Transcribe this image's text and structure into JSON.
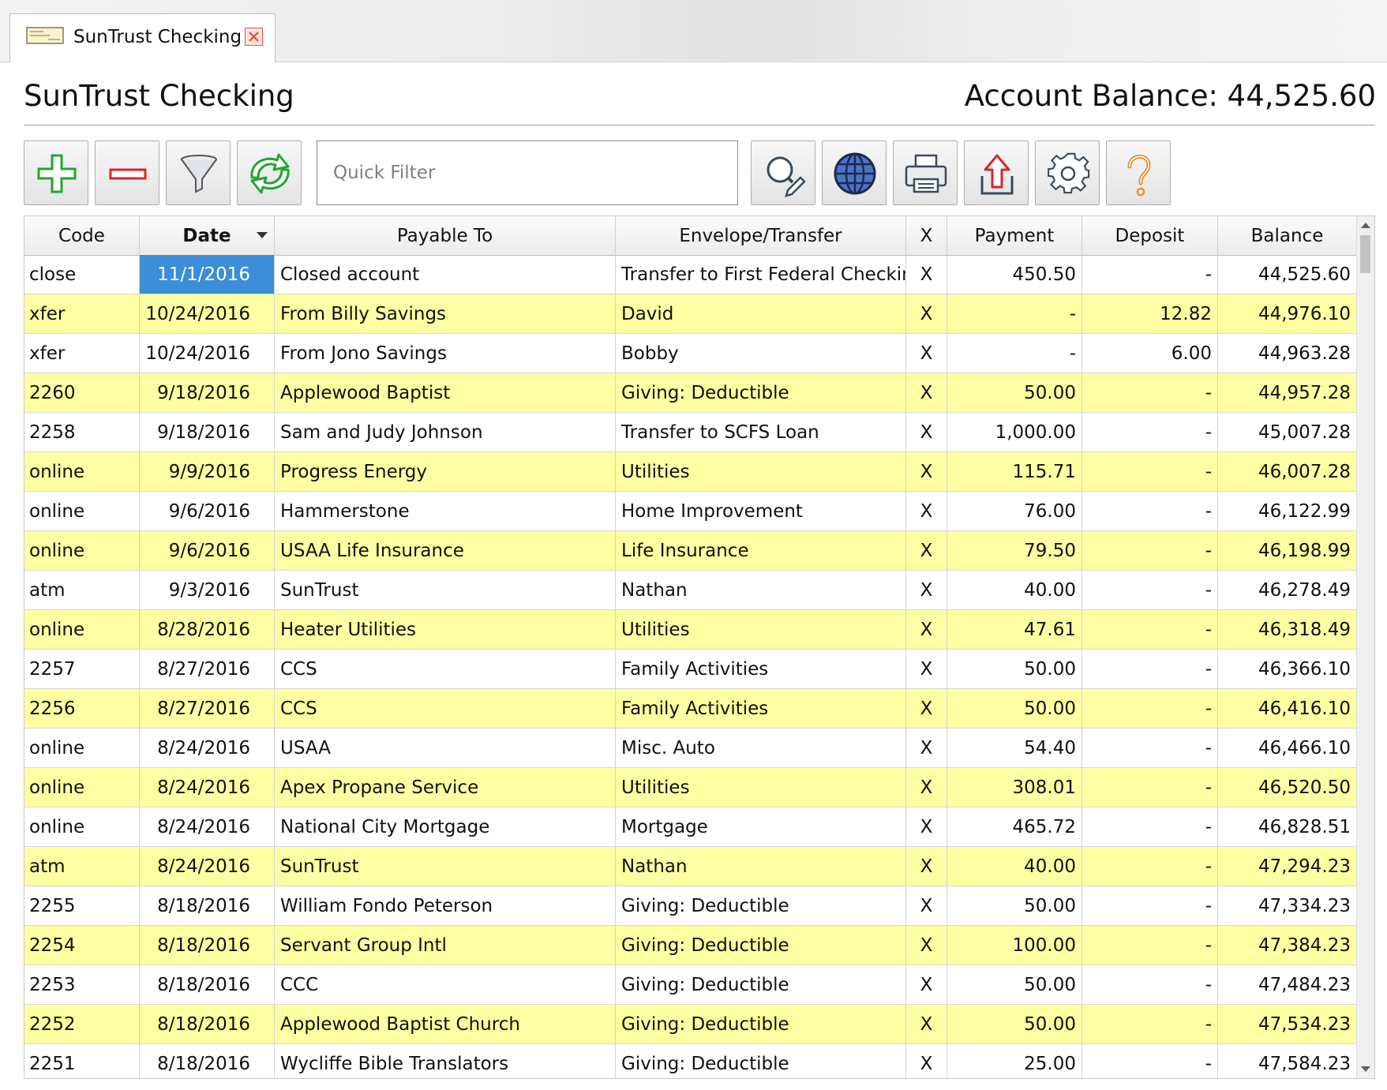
{
  "tab": {
    "title": "SunTrust Checking",
    "icon": "check-document-icon",
    "close_icon": "close-icon"
  },
  "header": {
    "title": "SunTrust Checking",
    "balance": "Account Balance: 44,525.60"
  },
  "toolbar": {
    "add_icon": "plus-icon",
    "delete_icon": "minus-icon",
    "filter_icon": "funnel-icon",
    "sync_icon": "sync-arrows-icon",
    "quick_filter_placeholder": "Quick Filter",
    "quick_filter_value": "",
    "search_icon": "magnifier-pencil-icon",
    "web_icon": "globe-icon",
    "print_icon": "printer-icon",
    "export_icon": "export-upload-icon",
    "settings_icon": "gear-icon",
    "help_icon": "question-mark-icon"
  },
  "colors": {
    "alt_row": "#fefea2",
    "selected_cell": "#3b8ed7",
    "add_green": "#22a52f",
    "delete_red": "#d9262e",
    "help_orange": "#f08a2a",
    "export_red": "#d7262c"
  },
  "grid": {
    "columns": [
      "Code",
      "Date",
      "Payable To",
      "Envelope/Transfer",
      "X",
      "Payment",
      "Deposit",
      "Balance"
    ],
    "sorted_column": "Date",
    "selected": {
      "row": 0,
      "column": "Date"
    },
    "rows": [
      {
        "code": "close",
        "date": "11/1/2016",
        "payee": "Closed account",
        "envelope": "Transfer to First Federal Checking",
        "x": "X",
        "payment": "450.50",
        "deposit": "-",
        "balance": "44,525.60"
      },
      {
        "code": "xfer",
        "date": "10/24/2016",
        "payee": "From Billy Savings",
        "envelope": "David",
        "x": "X",
        "payment": "-",
        "deposit": "12.82",
        "balance": "44,976.10"
      },
      {
        "code": "xfer",
        "date": "10/24/2016",
        "payee": "From Jono Savings",
        "envelope": "Bobby",
        "x": "X",
        "payment": "-",
        "deposit": "6.00",
        "balance": "44,963.28"
      },
      {
        "code": "2260",
        "date": "9/18/2016",
        "payee": "Applewood Baptist",
        "envelope": "Giving: Deductible",
        "x": "X",
        "payment": "50.00",
        "deposit": "-",
        "balance": "44,957.28"
      },
      {
        "code": "2258",
        "date": "9/18/2016",
        "payee": "Sam and Judy Johnson",
        "envelope": "Transfer to SCFS Loan",
        "x": "X",
        "payment": "1,000.00",
        "deposit": "-",
        "balance": "45,007.28"
      },
      {
        "code": "online",
        "date": "9/9/2016",
        "payee": "Progress Energy",
        "envelope": "Utilities",
        "x": "X",
        "payment": "115.71",
        "deposit": "-",
        "balance": "46,007.28"
      },
      {
        "code": "online",
        "date": "9/6/2016",
        "payee": "Hammerstone",
        "envelope": "Home Improvement",
        "x": "X",
        "payment": "76.00",
        "deposit": "-",
        "balance": "46,122.99"
      },
      {
        "code": "online",
        "date": "9/6/2016",
        "payee": "USAA Life Insurance",
        "envelope": "Life Insurance",
        "x": "X",
        "payment": "79.50",
        "deposit": "-",
        "balance": "46,198.99"
      },
      {
        "code": "atm",
        "date": "9/3/2016",
        "payee": "SunTrust",
        "envelope": "Nathan",
        "x": "X",
        "payment": "40.00",
        "deposit": "-",
        "balance": "46,278.49"
      },
      {
        "code": "online",
        "date": "8/28/2016",
        "payee": "Heater Utilities",
        "envelope": "Utilities",
        "x": "X",
        "payment": "47.61",
        "deposit": "-",
        "balance": "46,318.49"
      },
      {
        "code": "2257",
        "date": "8/27/2016",
        "payee": "CCS",
        "envelope": "Family Activities",
        "x": "X",
        "payment": "50.00",
        "deposit": "-",
        "balance": "46,366.10"
      },
      {
        "code": "2256",
        "date": "8/27/2016",
        "payee": "CCS",
        "envelope": "Family Activities",
        "x": "X",
        "payment": "50.00",
        "deposit": "-",
        "balance": "46,416.10"
      },
      {
        "code": "online",
        "date": "8/24/2016",
        "payee": "USAA",
        "envelope": "Misc. Auto",
        "x": "X",
        "payment": "54.40",
        "deposit": "-",
        "balance": "46,466.10"
      },
      {
        "code": "online",
        "date": "8/24/2016",
        "payee": "Apex Propane Service",
        "envelope": "Utilities",
        "x": "X",
        "payment": "308.01",
        "deposit": "-",
        "balance": "46,520.50"
      },
      {
        "code": "online",
        "date": "8/24/2016",
        "payee": "National City Mortgage",
        "envelope": "Mortgage",
        "x": "X",
        "payment": "465.72",
        "deposit": "-",
        "balance": "46,828.51"
      },
      {
        "code": "atm",
        "date": "8/24/2016",
        "payee": "SunTrust",
        "envelope": "Nathan",
        "x": "X",
        "payment": "40.00",
        "deposit": "-",
        "balance": "47,294.23"
      },
      {
        "code": "2255",
        "date": "8/18/2016",
        "payee": "William Fondo Peterson",
        "envelope": "Giving: Deductible",
        "x": "X",
        "payment": "50.00",
        "deposit": "-",
        "balance": "47,334.23"
      },
      {
        "code": "2254",
        "date": "8/18/2016",
        "payee": "Servant Group Intl",
        "envelope": "Giving: Deductible",
        "x": "X",
        "payment": "100.00",
        "deposit": "-",
        "balance": "47,384.23"
      },
      {
        "code": "2253",
        "date": "8/18/2016",
        "payee": "CCC",
        "envelope": "Giving: Deductible",
        "x": "X",
        "payment": "50.00",
        "deposit": "-",
        "balance": "47,484.23"
      },
      {
        "code": "2252",
        "date": "8/18/2016",
        "payee": "Applewood Baptist Church",
        "envelope": "Giving: Deductible",
        "x": "X",
        "payment": "50.00",
        "deposit": "-",
        "balance": "47,534.23"
      },
      {
        "code": "2251",
        "date": "8/18/2016",
        "payee": "Wycliffe Bible Translators",
        "envelope": "Giving: Deductible",
        "x": "X",
        "payment": "25.00",
        "deposit": "-",
        "balance": "47,584.23"
      }
    ]
  }
}
